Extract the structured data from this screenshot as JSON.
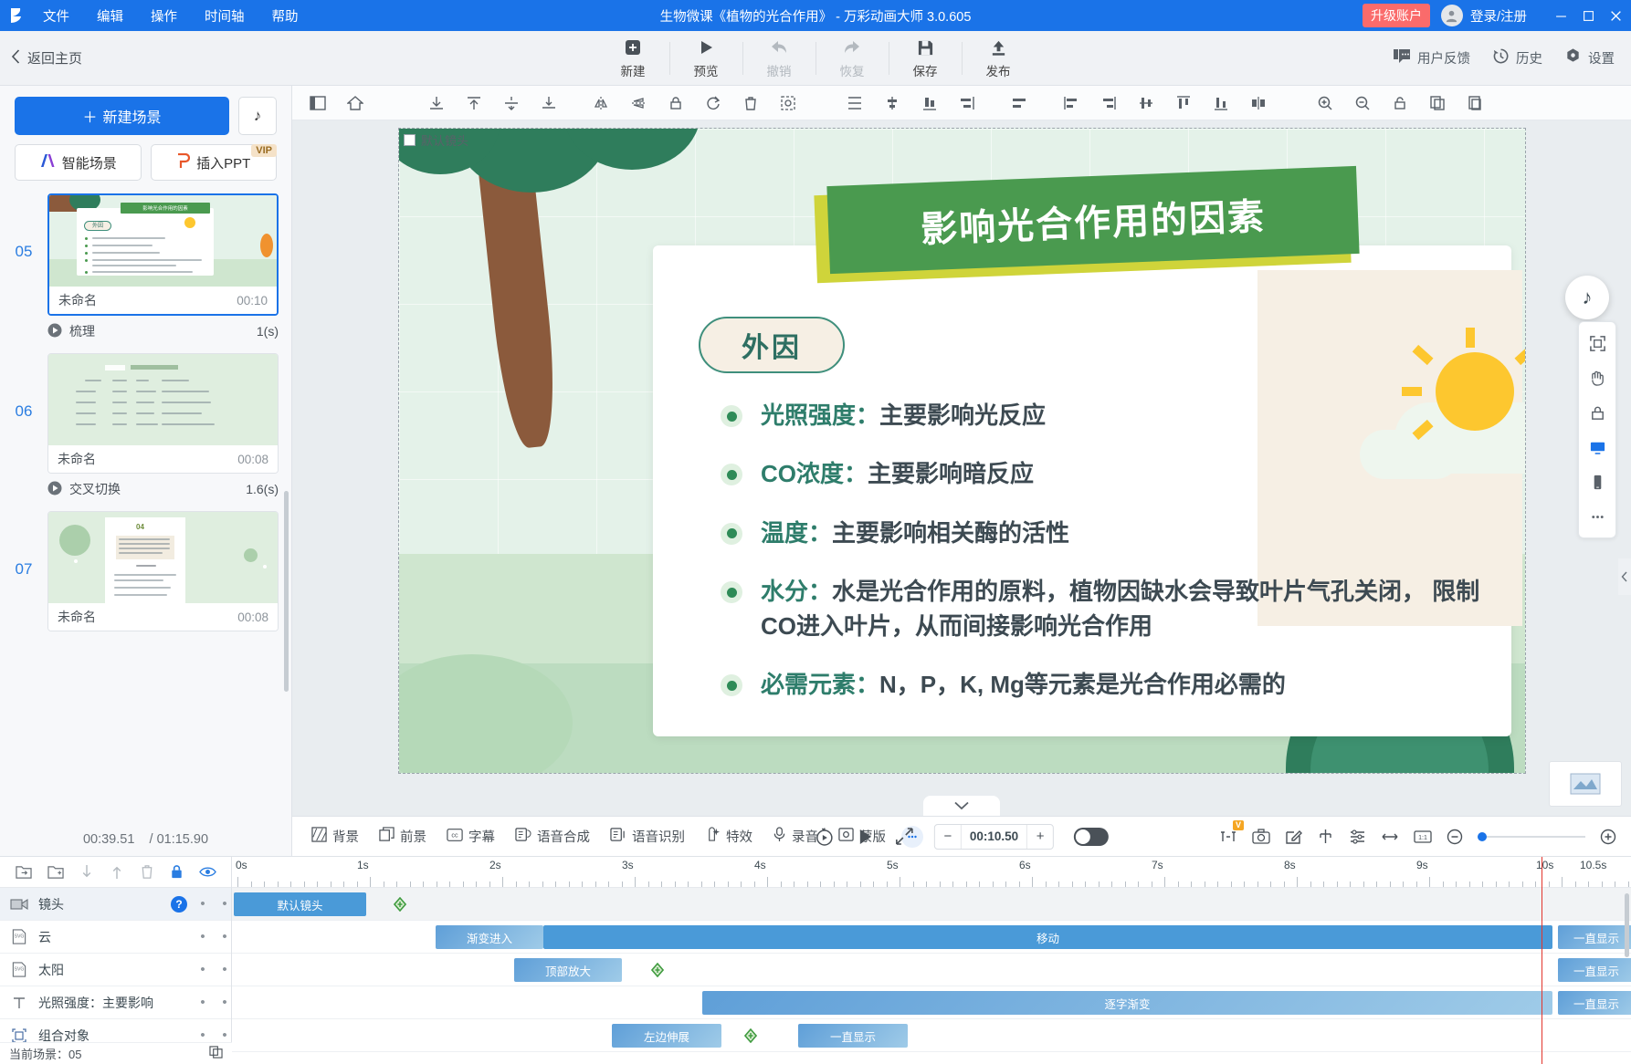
{
  "titlebar": {
    "menus": [
      "文件",
      "编辑",
      "操作",
      "时间轴",
      "帮助"
    ],
    "title": "生物微课《植物的光合作用》 - 万彩动画大师 3.0.605",
    "upgrade_label": "升级账户",
    "login_label": "登录/注册",
    "accent": "#1a73e8",
    "upgrade_color": "#fa6b6b"
  },
  "header": {
    "back_label": "返回主页",
    "buttons": [
      {
        "label": "新建",
        "icon": "plus-square-icon",
        "disabled": false
      },
      {
        "label": "预览",
        "icon": "play-icon",
        "disabled": false
      },
      {
        "label": "撤销",
        "icon": "undo-arrow-icon",
        "disabled": true
      },
      {
        "label": "恢复",
        "icon": "redo-arrow-icon",
        "disabled": true
      },
      {
        "label": "保存",
        "icon": "floppy-disk-icon",
        "disabled": false
      },
      {
        "label": "发布",
        "icon": "upload-icon",
        "disabled": false
      }
    ],
    "right_items": [
      {
        "label": "用户反馈",
        "icon": "feedback-icon"
      },
      {
        "label": "历史",
        "icon": "history-clock-icon"
      },
      {
        "label": "设置",
        "icon": "gear-icon"
      }
    ]
  },
  "sidebar": {
    "new_scene_label": "新建场景",
    "music_icon": "music-note-icon",
    "smart_scene_label": "智能场景",
    "insert_ppt_label": "插入PPT",
    "vip_badge": "VIP",
    "scenes": [
      {
        "num": "05",
        "name": "未命名",
        "duration": "00:10",
        "selected": true,
        "transition": "梳理",
        "transition_time": "1(s)"
      },
      {
        "num": "06",
        "name": "未命名",
        "duration": "00:08",
        "selected": false,
        "transition": "交叉切换",
        "transition_time": "1.6(s)"
      },
      {
        "num": "07",
        "name": "未命名",
        "duration": "00:08",
        "selected": false,
        "transition": "",
        "transition_time": ""
      }
    ],
    "time_current": "00:39.51",
    "time_total": "/ 01:15.90"
  },
  "canvas_toolbar": {
    "icons": [
      "layout-frame-icon",
      "home-icon",
      "sep",
      "align-download-icon",
      "align-top-icon",
      "align-bottom-icon",
      "align-middle-icon",
      "flip-horizontal-icon",
      "flip-vertical-icon",
      "lock-icon",
      "rotate-icon",
      "delete-icon",
      "select-all-icon",
      "sep",
      "align-left-icon",
      "align-center-h-icon",
      "align-right-icon",
      "align-justify-icon",
      "sep",
      "distribute-icon",
      "distribute-left-icon",
      "distribute-right-icon",
      "align-v-center-icon",
      "align-v-top-icon",
      "align-v-bottom-icon",
      "distribute-v-icon",
      "sep",
      "zoom-in-icon",
      "zoom-out-icon",
      "lock-ratio-icon",
      "copy-icon",
      "paste-icon"
    ]
  },
  "stage": {
    "camera_label": "默认镜头",
    "slide": {
      "title": "影响光合作用的因素",
      "pill": "外因",
      "bullets": [
        {
          "key": "光照强度：",
          "rest": "主要影响光反应"
        },
        {
          "key": "CO浓度：",
          "rest": "主要影响暗反应"
        },
        {
          "key": "温度：",
          "rest": "主要影响相关酶的活性"
        },
        {
          "key": "水分：",
          "rest": "水是光合作用的原料，植物因缺水会导致叶片气孔关闭， 限制CO进入叶片，从而间接影响光合作用"
        },
        {
          "key": "必需元素：",
          "rest": "N，P，K, Mg等元素是光合作用必需的"
        }
      ],
      "title_bg": "#4a9a4f",
      "title_shadow": "#cfd43a"
    },
    "dock_icons": [
      "fit-screen-icon",
      "hand-icon",
      "lock-icon",
      "desktop-icon",
      "mobile-icon",
      "more-dots-icon"
    ]
  },
  "bottom_tools": {
    "items": [
      {
        "label": "背景",
        "icon": "background-icon"
      },
      {
        "label": "前景",
        "icon": "foreground-icon"
      },
      {
        "label": "字幕",
        "icon": "subtitle-cc-icon"
      },
      {
        "label": "语音合成",
        "icon": "tts-icon"
      },
      {
        "label": "语音识别",
        "icon": "asr-icon"
      },
      {
        "label": "特效",
        "icon": "effects-icon"
      },
      {
        "label": "录音",
        "icon": "microphone-icon"
      },
      {
        "label": "蒙版",
        "icon": "mask-icon"
      }
    ],
    "more_icon": "more-dots-icon",
    "replay_icon": "replay-icon",
    "play_icon": "play-icon",
    "fullscreen_icon": "expand-arrows-icon",
    "time_value": "00:10.50",
    "minus_label": "−",
    "plus_label": "+",
    "right_icons": [
      {
        "icon": "fit-width-icon",
        "badge": "V"
      },
      {
        "icon": "camera-icon",
        "badge": ""
      },
      {
        "icon": "edit-square-icon",
        "badge": ""
      },
      {
        "icon": "branch-icon",
        "badge": ""
      },
      {
        "icon": "settings-sliders-icon",
        "badge": ""
      },
      {
        "icon": "arrows-lr-icon",
        "badge": ""
      },
      {
        "icon": "ratio-icon",
        "badge": ""
      }
    ],
    "zoom_out_icon": "zoom-out-circle-icon",
    "zoom_in_icon": "zoom-in-circle-icon"
  },
  "timeline": {
    "tools": [
      "import-icon",
      "new-folder-icon",
      "move-down-icon",
      "move-up-icon",
      "delete-icon",
      "lock-icon",
      "eye-icon"
    ],
    "ruler_labels": [
      "0s",
      "1s",
      "2s",
      "3s",
      "4s",
      "5s",
      "6s",
      "7s",
      "8s",
      "9s",
      "10s",
      "10.5s"
    ],
    "playhead_time": "10s",
    "tracks": [
      {
        "icon": "camera-track-icon",
        "name": "镜头",
        "has_help": true,
        "selected": true,
        "clips": [
          {
            "label": "默认镜头",
            "start": 0.0,
            "end": 1.0,
            "style": "solid"
          }
        ],
        "keyframes": [
          1.22
        ]
      },
      {
        "icon": "svg-track-icon",
        "name": "云",
        "has_help": false,
        "selected": false,
        "clips": [
          {
            "label": "渐变进入",
            "start": 1.54,
            "end": 2.35,
            "style": "light"
          },
          {
            "label": "移动",
            "start": 2.35,
            "end": 9.98,
            "style": "solid"
          },
          {
            "label": "一直显示",
            "start": 10.05,
            "end": 10.5,
            "style": "light"
          }
        ],
        "keyframes": []
      },
      {
        "icon": "svg-track-icon",
        "name": "太阳",
        "has_help": false,
        "selected": false,
        "clips": [
          {
            "label": "顶部放大",
            "start": 2.13,
            "end": 2.93,
            "style": "light"
          },
          {
            "label": "一直显示",
            "start": 10.05,
            "end": 10.5,
            "style": "light"
          }
        ],
        "keyframes": [
          3.22
        ]
      },
      {
        "icon": "text-track-icon",
        "name": "光照强度：主要影响",
        "has_help": false,
        "selected": false,
        "clips": [
          {
            "label": "逐字渐变",
            "start": 3.55,
            "end": 9.98,
            "style": "light"
          },
          {
            "label": "一直显示",
            "start": 10.05,
            "end": 10.5,
            "style": "light"
          }
        ],
        "keyframes": []
      },
      {
        "icon": "group-track-icon",
        "name": "组合对象",
        "has_help": false,
        "selected": false,
        "clips": [
          {
            "label": "左边伸展",
            "start": 2.87,
            "end": 3.7,
            "style": "light"
          },
          {
            "label": "一直显示",
            "start": 4.27,
            "end": 5.1,
            "style": "light"
          }
        ],
        "keyframes": [
          4.0
        ]
      }
    ],
    "status_label": "当前场景：05",
    "status_icon": "duplicate-icon"
  }
}
